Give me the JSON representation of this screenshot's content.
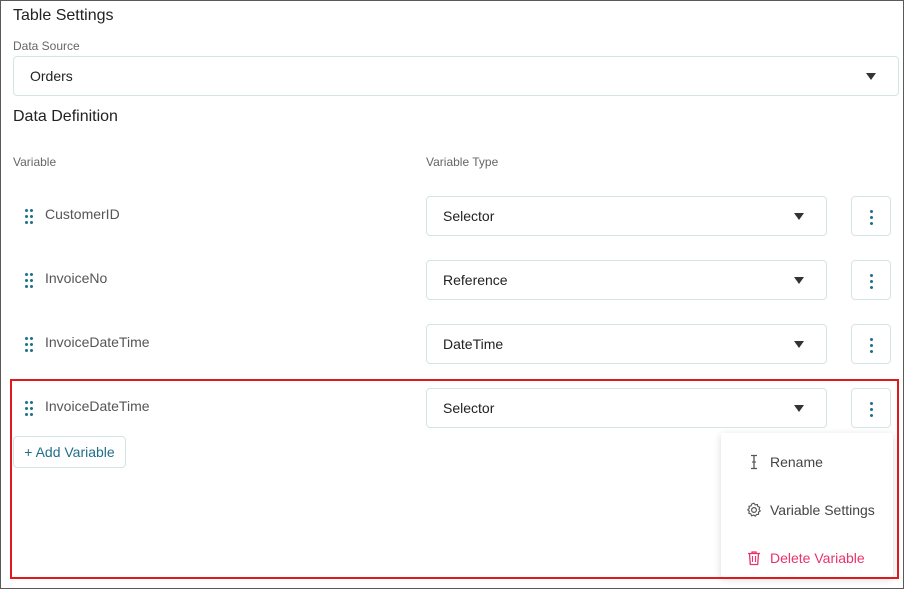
{
  "table_settings": {
    "title": "Table Settings"
  },
  "data_source": {
    "label": "Data Source",
    "value": "Orders"
  },
  "data_definition": {
    "title": "Data Definition",
    "column_variable": "Variable",
    "column_type": "Variable Type",
    "rows": [
      {
        "name": "CustomerID",
        "type": "Selector"
      },
      {
        "name": "InvoiceNo",
        "type": "Reference"
      },
      {
        "name": "InvoiceDateTime",
        "type": "DateTime"
      },
      {
        "name": "InvoiceDateTime",
        "type": "Selector"
      }
    ],
    "add_button": "+ Add Variable"
  },
  "context_menu": {
    "items": [
      {
        "label": "Rename",
        "icon": "text-cursor-icon"
      },
      {
        "label": "Variable Settings",
        "icon": "gear-icon"
      },
      {
        "label": "Delete Variable",
        "icon": "trash-icon"
      }
    ]
  },
  "colors": {
    "accent": "#1f6f8b",
    "highlight": "#e0191d",
    "danger": "#e8336b",
    "border": "#d3e6e6"
  }
}
